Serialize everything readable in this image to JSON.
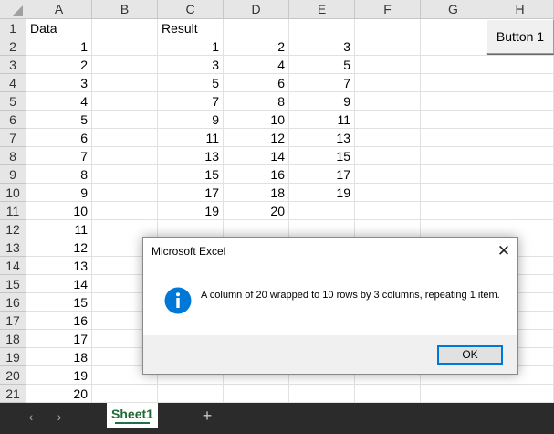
{
  "spreadsheet": {
    "columns": [
      "A",
      "B",
      "C",
      "D",
      "E",
      "F",
      "G",
      "H"
    ],
    "rows": [
      "1",
      "2",
      "3",
      "4",
      "5",
      "6",
      "7",
      "8",
      "9",
      "10",
      "11",
      "12",
      "13",
      "14",
      "15",
      "16",
      "17",
      "18",
      "19",
      "20",
      "21"
    ],
    "cells": {
      "A1": "Data",
      "C1": "Result",
      "A2": "1",
      "A3": "2",
      "A4": "3",
      "A5": "4",
      "A6": "5",
      "A7": "6",
      "A8": "7",
      "A9": "8",
      "A10": "9",
      "A11": "10",
      "A12": "11",
      "A13": "12",
      "A14": "13",
      "A15": "14",
      "A16": "15",
      "A17": "16",
      "A18": "17",
      "A19": "18",
      "A20": "19",
      "A21": "20",
      "C2": "1",
      "D2": "2",
      "E2": "3",
      "C3": "3",
      "D3": "4",
      "E3": "5",
      "C4": "5",
      "D4": "6",
      "E4": "7",
      "C5": "7",
      "D5": "8",
      "E5": "9",
      "C6": "9",
      "D6": "10",
      "E6": "11",
      "C7": "11",
      "D7": "12",
      "E7": "13",
      "C8": "13",
      "D8": "14",
      "E8": "15",
      "C9": "15",
      "D9": "16",
      "E9": "17",
      "C10": "17",
      "D10": "18",
      "E10": "19",
      "C11": "19",
      "D11": "20"
    },
    "button_label": "Button 1"
  },
  "tabs": {
    "prev_icon": "chevron-left-icon",
    "next_icon": "chevron-right-icon",
    "sheets": [
      "Sheet1"
    ],
    "active": "Sheet1",
    "add_icon": "plus-icon"
  },
  "dialog": {
    "title": "Microsoft Excel",
    "icon": "info-icon",
    "message": "A column of 20 wrapped to 10 rows by 3 columns, repeating 1 item.",
    "ok_label": "OK",
    "close_icon": "close-icon",
    "accent_color": "#0078d7"
  }
}
